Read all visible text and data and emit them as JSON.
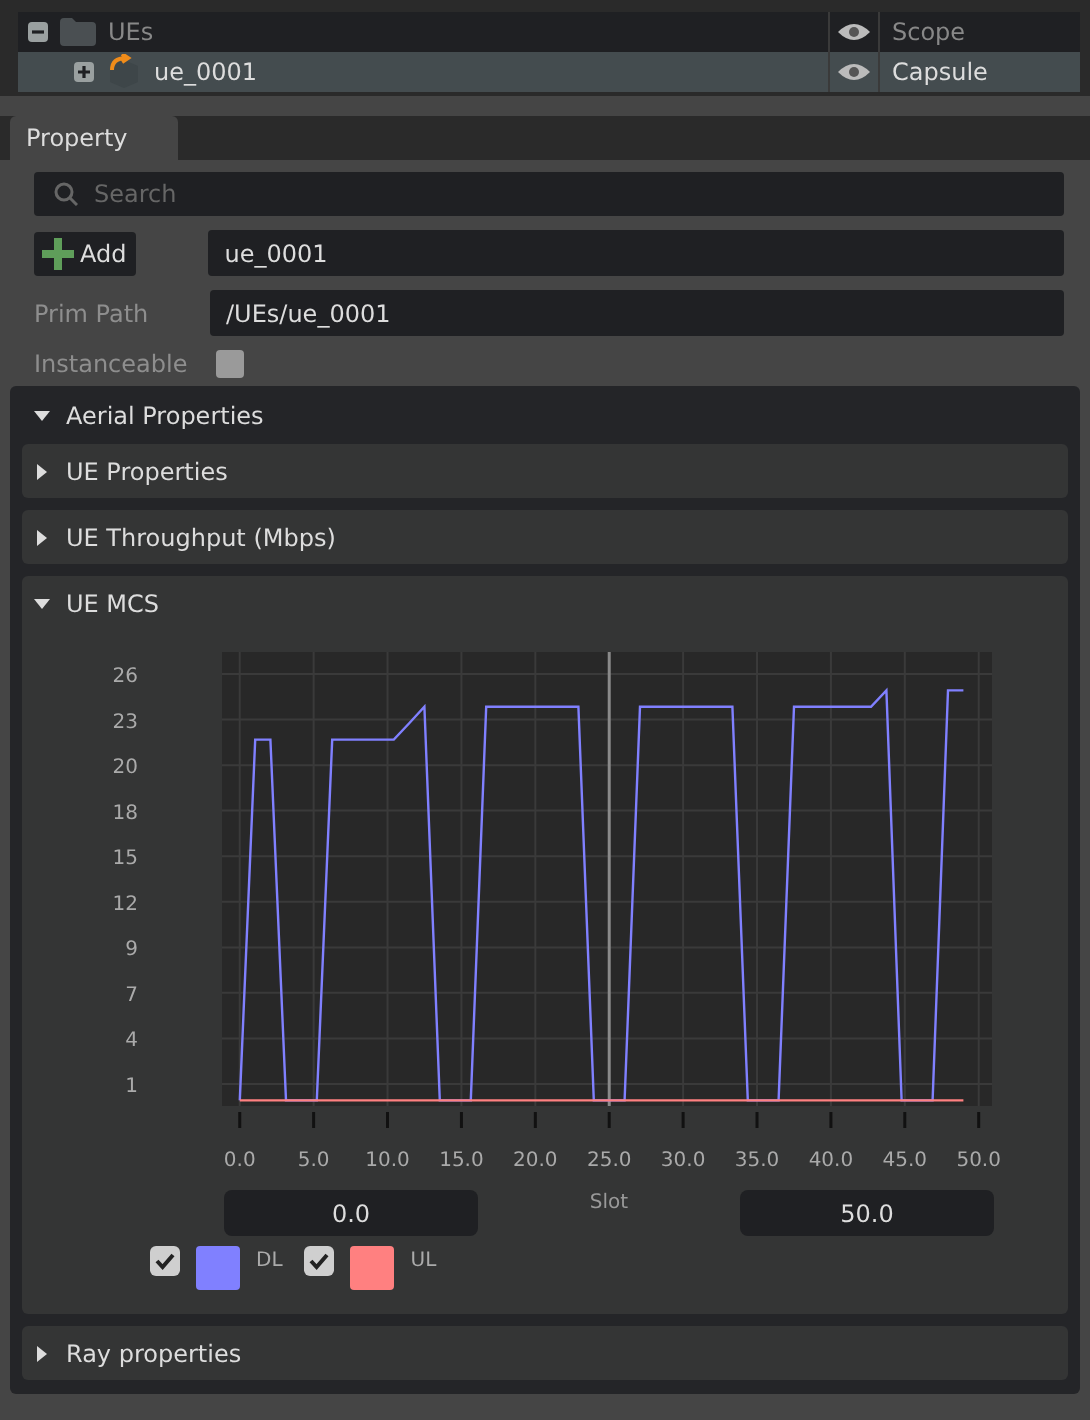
{
  "stage_tree": {
    "rows": [
      {
        "label": "UEs",
        "kind": "folder",
        "expanded": true,
        "selected": false,
        "visible": true,
        "type": "Scope",
        "children": [
          {
            "label": "ue_0001",
            "kind": "prim",
            "expanded": false,
            "selected": true,
            "visible": true,
            "type": "Capsule"
          }
        ]
      }
    ]
  },
  "property_panel": {
    "tab": {
      "label": "Property",
      "selected": true
    },
    "search": {
      "placeholder": "Search"
    },
    "add_button": "Add",
    "name_value": "ue_0001",
    "prim_path": {
      "label": "Prim Path",
      "value": "/UEs/ue_0001"
    },
    "instanceable": {
      "label": "Instanceable",
      "checked": false
    },
    "sections": [
      {
        "title": "Aerial Properties",
        "expanded": true,
        "children": [
          {
            "title": "UE Properties",
            "expanded": false
          },
          {
            "title": "UE Throughput (Mbps)",
            "expanded": false
          },
          {
            "title": "UE MCS",
            "expanded": true,
            "chart_data": {
              "type": "line",
              "xlabel": "Slot",
              "x": [
                0,
                1.04,
                2.08,
                3.13,
                4.17,
                5.21,
                6.25,
                7.29,
                8.33,
                9.38,
                10.42,
                11.46,
                12.5,
                13.54,
                14.58,
                15.63,
                16.67,
                17.71,
                18.75,
                19.79,
                20.83,
                21.88,
                22.92,
                23.96,
                25,
                26.04,
                27.08,
                28.13,
                29.17,
                30.21,
                31.25,
                32.29,
                33.33,
                34.38,
                35.42,
                36.46,
                37.5,
                38.54,
                39.58,
                40.63,
                41.67,
                42.71,
                43.75,
                44.79,
                45.83,
                46.88,
                47.92,
                48.96
              ],
              "series": [
                {
                  "name": "DL",
                  "color": "#8080ff",
                  "values": [
                    0,
                    22,
                    22,
                    0,
                    0,
                    0,
                    22,
                    22,
                    22,
                    22,
                    22,
                    23,
                    24,
                    0,
                    0,
                    0,
                    24,
                    24,
                    24,
                    24,
                    24,
                    24,
                    24,
                    0,
                    0,
                    0,
                    24,
                    24,
                    24,
                    24,
                    24,
                    24,
                    24,
                    0,
                    0,
                    0,
                    24,
                    24,
                    24,
                    24,
                    24,
                    24,
                    25,
                    0,
                    0,
                    0,
                    25,
                    25
                  ]
                },
                {
                  "name": "UL",
                  "color": "#ff8080",
                  "values": [
                    0,
                    0,
                    0,
                    0,
                    0,
                    0,
                    0,
                    0,
                    0,
                    0,
                    0,
                    0,
                    0,
                    0,
                    0,
                    0,
                    0,
                    0,
                    0,
                    0,
                    0,
                    0,
                    0,
                    0,
                    0,
                    0,
                    0,
                    0,
                    0,
                    0,
                    0,
                    0,
                    0,
                    0,
                    0,
                    0,
                    0,
                    0,
                    0,
                    0,
                    0,
                    0,
                    0,
                    0,
                    0,
                    0,
                    0,
                    0
                  ]
                }
              ],
              "xlim": [
                -1.2,
                50.9
              ],
              "ylim": [
                -0.34,
                27.34
              ],
              "xticks": [
                {
                  "value": 0,
                  "label": "0.0"
                },
                {
                  "value": 5,
                  "label": "5.0"
                },
                {
                  "value": 10,
                  "label": "10.0"
                },
                {
                  "value": 15,
                  "label": "15.0"
                },
                {
                  "value": 20,
                  "label": "20.0"
                },
                {
                  "value": 25,
                  "label": "25.0"
                },
                {
                  "value": 30,
                  "label": "30.0"
                },
                {
                  "value": 35,
                  "label": "35.0"
                },
                {
                  "value": 40,
                  "label": "40.0"
                },
                {
                  "value": 45,
                  "label": "45.0"
                },
                {
                  "value": 50,
                  "label": "50.0"
                }
              ],
              "yticks": [
                {
                  "value": 1,
                  "label": "1"
                },
                {
                  "value": 3.78,
                  "label": "4"
                },
                {
                  "value": 6.56,
                  "label": "7"
                },
                {
                  "value": 9.33,
                  "label": "9"
                },
                {
                  "value": 12.11,
                  "label": "12"
                },
                {
                  "value": 14.89,
                  "label": "15"
                },
                {
                  "value": 17.67,
                  "label": "18"
                },
                {
                  "value": 20.44,
                  "label": "20"
                },
                {
                  "value": 23.22,
                  "label": "23"
                },
                {
                  "value": 26,
                  "label": "26"
                }
              ],
              "grid": true,
              "ref_lines": [
                {
                  "axis": "x",
                  "value": 25
                }
              ]
            },
            "range": {
              "min": "0.0",
              "max": "50.0"
            },
            "legend": [
              {
                "checked": true
              },
              {
                "checked": true
              }
            ]
          },
          {
            "title": "Ray properties",
            "expanded": false
          }
        ]
      }
    ]
  }
}
